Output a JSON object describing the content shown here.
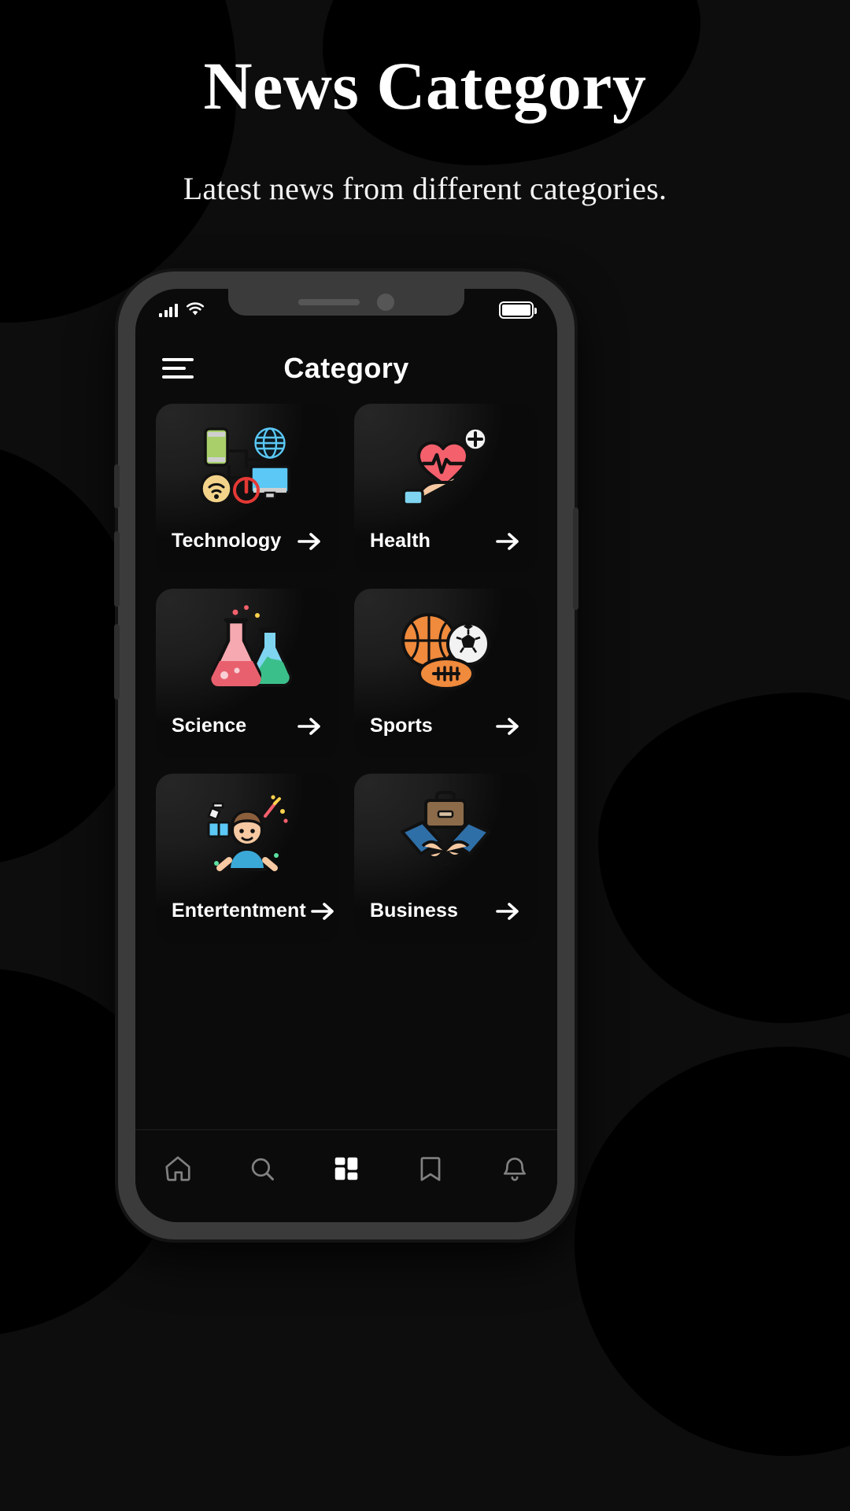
{
  "page": {
    "title": "News Category",
    "subtitle": "Latest news from different categories."
  },
  "colors": {
    "background": "#0d0d0d",
    "blob": "#000000",
    "phone_frame": "#3b3b3b",
    "screen": "#0b0b0b",
    "card": "#161616",
    "text_primary": "#ffffff",
    "accent_red": "#f4606c",
    "accent_blue": "#5bc8f5",
    "accent_orange": "#f08a3c"
  },
  "phone": {
    "status_bar": {
      "signal_icon": "signal-bars-icon",
      "signal_bars": 4,
      "wifi_icon": "wifi-icon",
      "battery_icon": "battery-icon",
      "battery_level": 100
    },
    "header": {
      "menu_icon": "hamburger-menu-icon",
      "title": "Category"
    },
    "categories": [
      {
        "name": "Technology",
        "icon": "technology-icon",
        "arrow": "arrow-right-icon"
      },
      {
        "name": "Health",
        "icon": "health-heart-icon",
        "arrow": "arrow-right-icon"
      },
      {
        "name": "Science",
        "icon": "science-flask-icon",
        "arrow": "arrow-right-icon"
      },
      {
        "name": "Sports",
        "icon": "sports-balls-icon",
        "arrow": "arrow-right-icon"
      },
      {
        "name": "Entertentment",
        "icon": "entertainment-icon",
        "arrow": "arrow-right-icon"
      },
      {
        "name": "Business",
        "icon": "business-icon",
        "arrow": "arrow-right-icon"
      }
    ],
    "bottom_nav": [
      {
        "icon": "home-icon",
        "active": false
      },
      {
        "icon": "search-icon",
        "active": false
      },
      {
        "icon": "grid-icon",
        "active": true
      },
      {
        "icon": "bookmark-icon",
        "active": false
      },
      {
        "icon": "bell-icon",
        "active": false
      }
    ]
  }
}
